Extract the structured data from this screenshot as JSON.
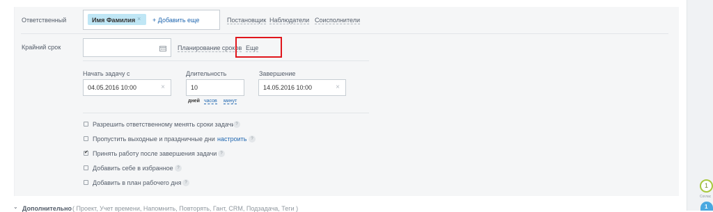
{
  "responsible": {
    "label": "Ответственный",
    "assignee": "Имя Фамилия",
    "remove_icon": "close-icon",
    "add_more": "+ Добавить еще",
    "roles": [
      "Постановщик",
      "Наблюдатели",
      "Соисполнители"
    ]
  },
  "deadline": {
    "label": "Крайний срок",
    "value": "",
    "calendar_icon": "calendar-icon",
    "planning_link": "Планирование сроков",
    "more_link": "Еще"
  },
  "planning": {
    "start_label": "Начать задачу с",
    "start_value": "04.05.2016 10:00",
    "duration_label": "Длительность",
    "duration_value": "10",
    "units": [
      "дней",
      "часов",
      "минут"
    ],
    "end_label": "Завершение",
    "end_value": "14.05.2016 10:00"
  },
  "options": [
    {
      "label": "Разрешить ответственному менять сроки задачи",
      "checked": false,
      "help": "?"
    },
    {
      "label": "Пропустить выходные и праздничные дни",
      "checked": false,
      "help": "?",
      "extra_link": "настроить"
    },
    {
      "label": "Принять работу после завершения задачи",
      "checked": true,
      "help": "?"
    },
    {
      "label": "Добавить себе в избранное",
      "checked": false,
      "help": "?"
    },
    {
      "label": "Добавить в план рабочего дня",
      "checked": false,
      "help": "?"
    }
  ],
  "additional": {
    "toggle_icon": "chevron-down-icon",
    "label": "Дополнительно",
    "items": "( Проект,  Учет времени,  Напомнить,  Повторять,  Гант,  CRM,  Подзадача,  Теги )"
  },
  "sidebar_widget": {
    "badge_count": "1",
    "caption": "Соглас",
    "second_badge": "1"
  },
  "colors": {
    "accent_link": "#2067b0",
    "tag_bg": "#bfe6f5",
    "highlight_box": "#e0151b",
    "badge_green": "#a8c83e",
    "badge_blue": "#4aa8e0"
  }
}
